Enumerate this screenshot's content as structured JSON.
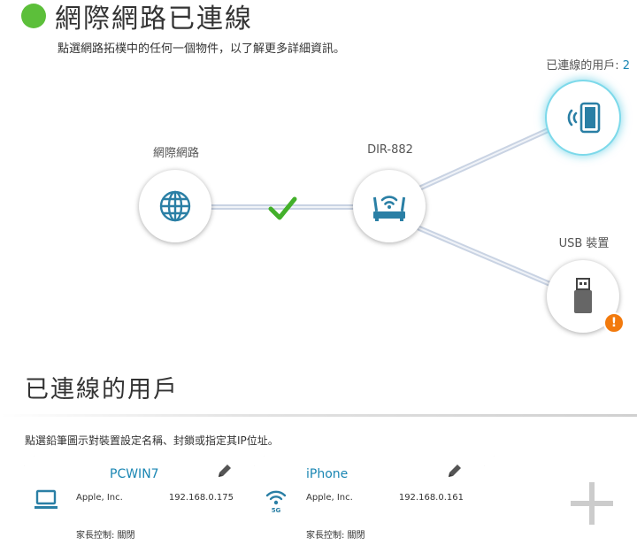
{
  "header": {
    "status_title": "網際網路已連線",
    "subtitle": "點選網路拓樸中的任何一個物件，以了解更多詳細資訊。",
    "status_color": "#5cbf3a"
  },
  "topology": {
    "internet": {
      "label": "網際網路",
      "icon": "globe-icon"
    },
    "router": {
      "label": "DIR-882",
      "icon": "router-icon"
    },
    "link_status_icon": "checkmark-icon",
    "clients": {
      "label_prefix": "已連線的用戶: ",
      "count": "2",
      "icon": "wireless-device-icon"
    },
    "usb": {
      "label": "USB 裝置",
      "icon": "usb-drive-icon",
      "alert": "!"
    }
  },
  "clients_section": {
    "title": "已連線的用戶",
    "instruction": "點選鉛筆圖示對裝置設定名稱、封鎖或指定其IP位址。",
    "cards": [
      {
        "name": "PCWIN7",
        "vendor": "Apple, Inc.",
        "ip": "192.168.0.175",
        "parental_control": "家長控制: 關閉",
        "icon": "computer-icon"
      },
      {
        "name": "iPhone",
        "vendor": "Apple, Inc.",
        "ip": "192.168.0.161",
        "parental_control": "家長控制: 關閉",
        "icon": "wifi-5g-icon",
        "icon_text": "5G"
      }
    ],
    "add_card_icon": "plus-icon"
  },
  "colors": {
    "accent": "#1a86b3",
    "icon_blue": "#2a7fa5",
    "alert": "#f27a0d",
    "check": "#43b02a",
    "link_line": "#d6dde8"
  }
}
